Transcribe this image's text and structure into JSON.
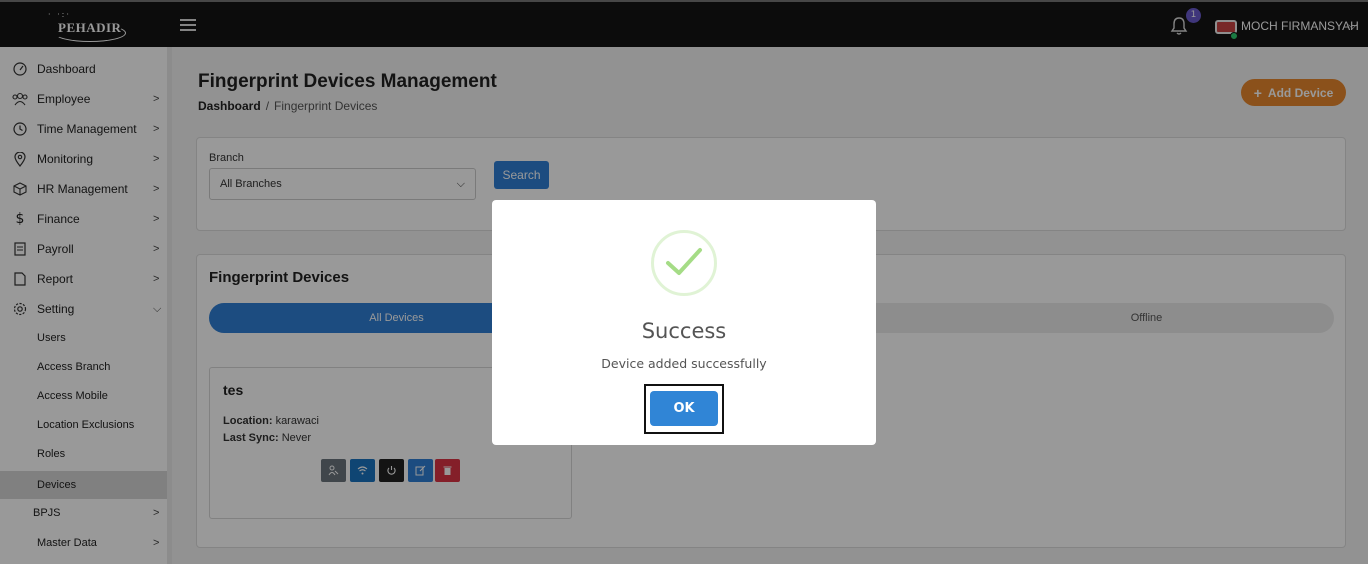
{
  "header": {
    "logo_text": "PEHADIR",
    "notification_count": "1",
    "user_name": "MOCH FIRMANSYAH"
  },
  "sidebar": {
    "items": [
      {
        "label": "Dashboard",
        "icon": "dashboard-icon"
      },
      {
        "label": "Employee",
        "icon": "employee-icon"
      },
      {
        "label": "Time Management",
        "icon": "clock-icon"
      },
      {
        "label": "Monitoring",
        "icon": "location-pin-icon"
      },
      {
        "label": "HR Management",
        "icon": "cube-icon"
      },
      {
        "label": "Finance",
        "icon": "dollar-icon"
      },
      {
        "label": "Payroll",
        "icon": "payroll-icon"
      },
      {
        "label": "Report",
        "icon": "file-icon"
      },
      {
        "label": "Setting",
        "icon": "gear-icon"
      }
    ],
    "setting_subitems": [
      "Users",
      "Access Branch",
      "Access Mobile",
      "Location Exclusions",
      "Roles",
      "Devices"
    ],
    "bpjs_label": "BPJS",
    "master_data_label": "Master Data"
  },
  "main": {
    "title": "Fingerprint Devices Management",
    "breadcrumb_home": "Dashboard",
    "breadcrumb_separator": "/",
    "breadcrumb_current": "Fingerprint Devices",
    "add_button_label": "Add Device",
    "filter": {
      "branch_label": "Branch",
      "branch_value": "All Branches",
      "search_label": "Search"
    },
    "devices": {
      "title": "Fingerprint Devices",
      "tabs": [
        {
          "label": "All Devices",
          "active": true
        },
        {
          "label": "Offline",
          "active": false
        }
      ],
      "cards": [
        {
          "name": "tes",
          "location_label": "Location:",
          "location": "karawaci",
          "last_sync_label": "Last Sync:",
          "last_sync": "Never"
        }
      ]
    }
  },
  "modal": {
    "title": "Success",
    "message": "Device added successfully",
    "ok_label": "OK"
  },
  "colors": {
    "topbar": "#141414",
    "primary": "#2f7fd6",
    "accent_orange": "#e8882d",
    "success_green": "#a5dc86",
    "danger": "#dc3545"
  }
}
